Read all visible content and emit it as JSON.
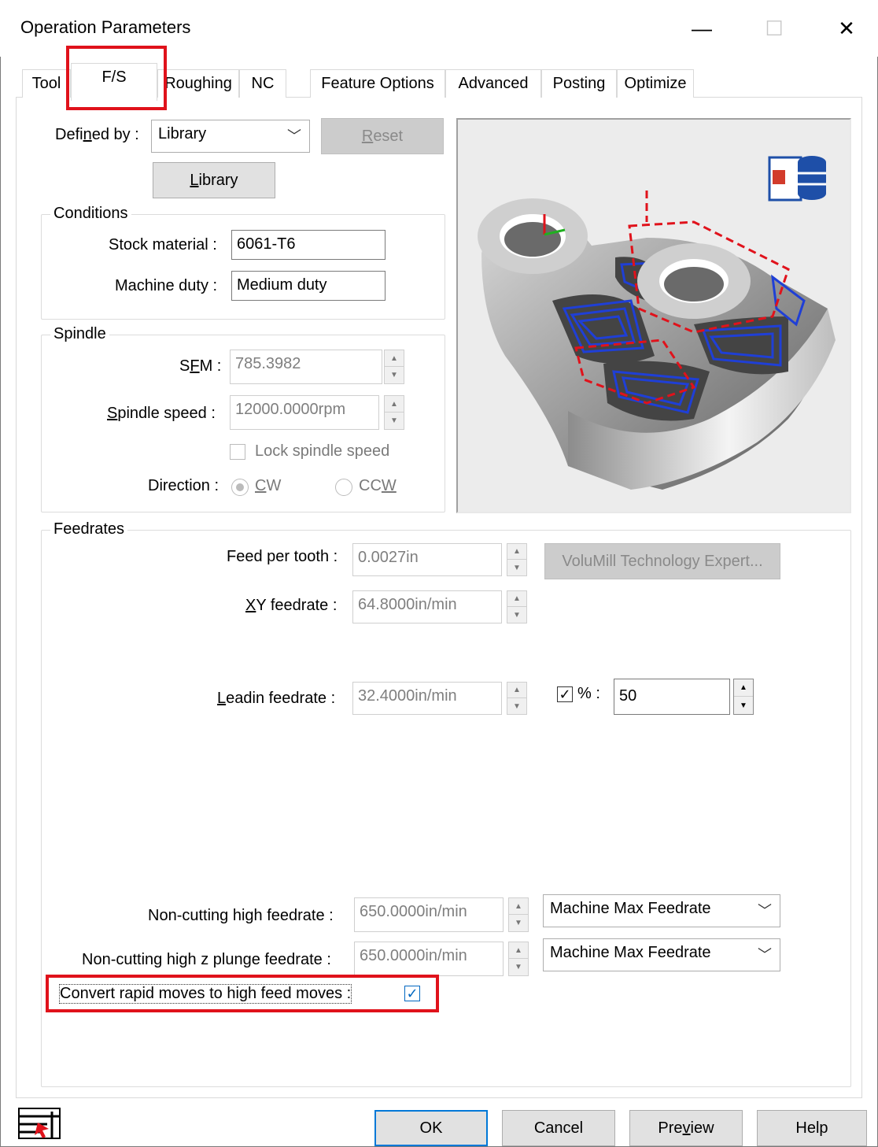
{
  "window": {
    "title": "Operation Parameters",
    "minimize_glyph": "—",
    "maximize_glyph": "☐",
    "close_glyph": "✕"
  },
  "tabs": [
    {
      "label": "Tool"
    },
    {
      "label": "F/S"
    },
    {
      "label": "Roughing"
    },
    {
      "label": "NC"
    },
    {
      "label": "Feature Options"
    },
    {
      "label": "Advanced"
    },
    {
      "label": "Posting"
    },
    {
      "label": "Optimize"
    }
  ],
  "active_tab": "F/S",
  "defined_by": {
    "label_pre": "Defi",
    "label_u": "n",
    "label_post": "ed by :",
    "value": "Library",
    "reset_u": "R",
    "reset_rest": "eset",
    "library_u": "L",
    "library_rest": "ibrary"
  },
  "conditions": {
    "title": "Conditions",
    "stock_material_label": "Stock material :",
    "stock_material_value": "6061-T6",
    "machine_duty_label": "Machine duty :",
    "machine_duty_value": "Medium duty"
  },
  "spindle": {
    "title": "Spindle",
    "sfm_pre": "S",
    "sfm_u": "F",
    "sfm_post": "M :",
    "sfm_value": "785.3982",
    "speed_u": "S",
    "speed_rest": "pindle speed :",
    "speed_value": "12000.0000rpm",
    "lock_label": "Lock spindle speed",
    "direction_label": "Direction :",
    "cw_u": "C",
    "cw_rest": "W",
    "ccw_pre": "CC",
    "ccw_u": "W"
  },
  "feedrates": {
    "title": "Feedrates",
    "feed_per_tooth_label": "Feed per tooth :",
    "feed_per_tooth_value": "0.0027in",
    "volumill_button": "VoluMill Technology Expert...",
    "xy_u": "X",
    "xy_rest": "Y feedrate :",
    "xy_value": "64.8000in/min",
    "leadin_u": "L",
    "leadin_rest": "eadin feedrate :",
    "leadin_value": "32.4000in/min",
    "percent_label": "% :",
    "percent_value": "50",
    "noncut_high_label": "Non-cutting high feedrate :",
    "noncut_high_value": "650.0000in/min",
    "noncut_high_mode": "Machine Max Feedrate",
    "noncut_z_label": "Non-cutting high z plunge feedrate :",
    "noncut_z_value": "650.0000in/min",
    "noncut_z_mode": "Machine Max Feedrate",
    "convert_label": "Convert rapid moves to high feed moves :"
  },
  "footer": {
    "ok": "OK",
    "cancel": "Cancel",
    "preview_pre": "Pre",
    "preview_u": "v",
    "preview_post": "iew",
    "help": "Help"
  },
  "colors": {
    "highlight_red": "#e0121b",
    "toolpath_blue": "#1f3fd6",
    "focus_blue": "#0078d7"
  }
}
